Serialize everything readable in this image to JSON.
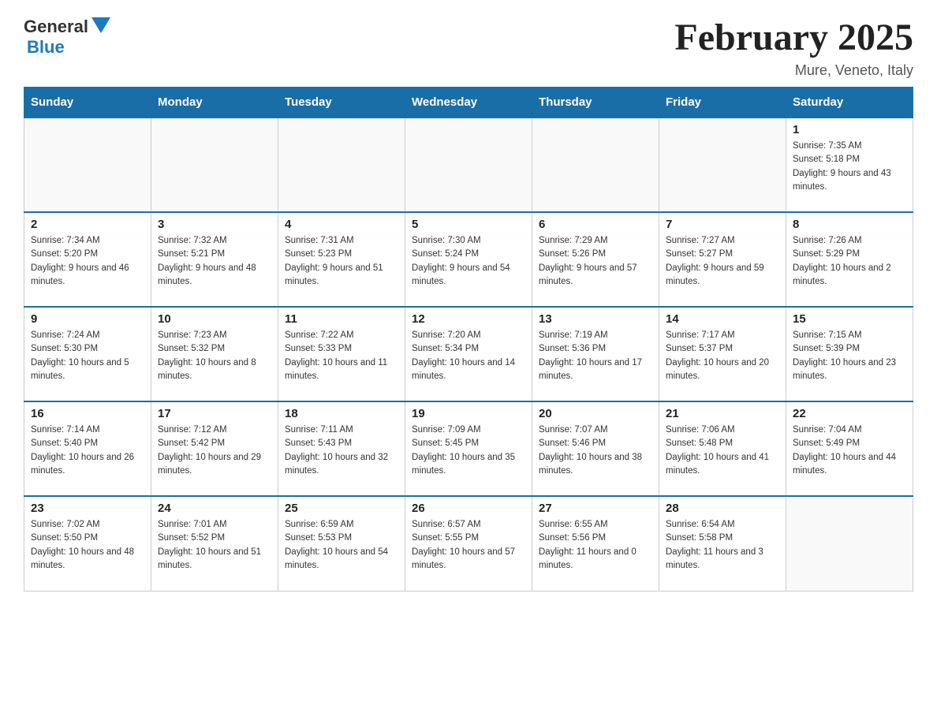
{
  "header": {
    "logo": {
      "general": "General",
      "blue": "Blue"
    },
    "title": "February 2025",
    "location": "Mure, Veneto, Italy"
  },
  "calendar": {
    "days_of_week": [
      "Sunday",
      "Monday",
      "Tuesday",
      "Wednesday",
      "Thursday",
      "Friday",
      "Saturday"
    ],
    "weeks": [
      [
        {
          "day": "",
          "info": ""
        },
        {
          "day": "",
          "info": ""
        },
        {
          "day": "",
          "info": ""
        },
        {
          "day": "",
          "info": ""
        },
        {
          "day": "",
          "info": ""
        },
        {
          "day": "",
          "info": ""
        },
        {
          "day": "1",
          "info": "Sunrise: 7:35 AM\nSunset: 5:18 PM\nDaylight: 9 hours and 43 minutes."
        }
      ],
      [
        {
          "day": "2",
          "info": "Sunrise: 7:34 AM\nSunset: 5:20 PM\nDaylight: 9 hours and 46 minutes."
        },
        {
          "day": "3",
          "info": "Sunrise: 7:32 AM\nSunset: 5:21 PM\nDaylight: 9 hours and 48 minutes."
        },
        {
          "day": "4",
          "info": "Sunrise: 7:31 AM\nSunset: 5:23 PM\nDaylight: 9 hours and 51 minutes."
        },
        {
          "day": "5",
          "info": "Sunrise: 7:30 AM\nSunset: 5:24 PM\nDaylight: 9 hours and 54 minutes."
        },
        {
          "day": "6",
          "info": "Sunrise: 7:29 AM\nSunset: 5:26 PM\nDaylight: 9 hours and 57 minutes."
        },
        {
          "day": "7",
          "info": "Sunrise: 7:27 AM\nSunset: 5:27 PM\nDaylight: 9 hours and 59 minutes."
        },
        {
          "day": "8",
          "info": "Sunrise: 7:26 AM\nSunset: 5:29 PM\nDaylight: 10 hours and 2 minutes."
        }
      ],
      [
        {
          "day": "9",
          "info": "Sunrise: 7:24 AM\nSunset: 5:30 PM\nDaylight: 10 hours and 5 minutes."
        },
        {
          "day": "10",
          "info": "Sunrise: 7:23 AM\nSunset: 5:32 PM\nDaylight: 10 hours and 8 minutes."
        },
        {
          "day": "11",
          "info": "Sunrise: 7:22 AM\nSunset: 5:33 PM\nDaylight: 10 hours and 11 minutes."
        },
        {
          "day": "12",
          "info": "Sunrise: 7:20 AM\nSunset: 5:34 PM\nDaylight: 10 hours and 14 minutes."
        },
        {
          "day": "13",
          "info": "Sunrise: 7:19 AM\nSunset: 5:36 PM\nDaylight: 10 hours and 17 minutes."
        },
        {
          "day": "14",
          "info": "Sunrise: 7:17 AM\nSunset: 5:37 PM\nDaylight: 10 hours and 20 minutes."
        },
        {
          "day": "15",
          "info": "Sunrise: 7:15 AM\nSunset: 5:39 PM\nDaylight: 10 hours and 23 minutes."
        }
      ],
      [
        {
          "day": "16",
          "info": "Sunrise: 7:14 AM\nSunset: 5:40 PM\nDaylight: 10 hours and 26 minutes."
        },
        {
          "day": "17",
          "info": "Sunrise: 7:12 AM\nSunset: 5:42 PM\nDaylight: 10 hours and 29 minutes."
        },
        {
          "day": "18",
          "info": "Sunrise: 7:11 AM\nSunset: 5:43 PM\nDaylight: 10 hours and 32 minutes."
        },
        {
          "day": "19",
          "info": "Sunrise: 7:09 AM\nSunset: 5:45 PM\nDaylight: 10 hours and 35 minutes."
        },
        {
          "day": "20",
          "info": "Sunrise: 7:07 AM\nSunset: 5:46 PM\nDaylight: 10 hours and 38 minutes."
        },
        {
          "day": "21",
          "info": "Sunrise: 7:06 AM\nSunset: 5:48 PM\nDaylight: 10 hours and 41 minutes."
        },
        {
          "day": "22",
          "info": "Sunrise: 7:04 AM\nSunset: 5:49 PM\nDaylight: 10 hours and 44 minutes."
        }
      ],
      [
        {
          "day": "23",
          "info": "Sunrise: 7:02 AM\nSunset: 5:50 PM\nDaylight: 10 hours and 48 minutes."
        },
        {
          "day": "24",
          "info": "Sunrise: 7:01 AM\nSunset: 5:52 PM\nDaylight: 10 hours and 51 minutes."
        },
        {
          "day": "25",
          "info": "Sunrise: 6:59 AM\nSunset: 5:53 PM\nDaylight: 10 hours and 54 minutes."
        },
        {
          "day": "26",
          "info": "Sunrise: 6:57 AM\nSunset: 5:55 PM\nDaylight: 10 hours and 57 minutes."
        },
        {
          "day": "27",
          "info": "Sunrise: 6:55 AM\nSunset: 5:56 PM\nDaylight: 11 hours and 0 minutes."
        },
        {
          "day": "28",
          "info": "Sunrise: 6:54 AM\nSunset: 5:58 PM\nDaylight: 11 hours and 3 minutes."
        },
        {
          "day": "",
          "info": ""
        }
      ]
    ]
  }
}
